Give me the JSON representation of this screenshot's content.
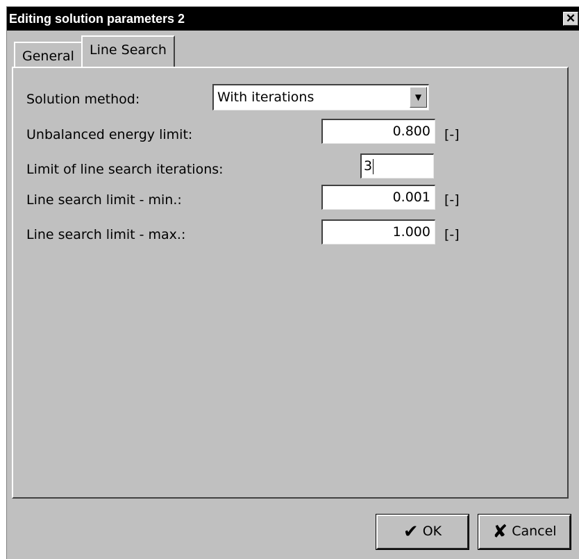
{
  "window": {
    "title": "Editing solution parameters 2",
    "close_glyph": "✕"
  },
  "tabs": [
    {
      "label": "General",
      "active": false
    },
    {
      "label": "Line Search",
      "active": true
    }
  ],
  "form": {
    "solution_method": {
      "label": "Solution method:",
      "value": "With iterations",
      "dropdown_glyph": "▼"
    },
    "unbalanced_energy_limit": {
      "label": "Unbalanced energy limit:",
      "value": "0.800",
      "unit": "[-]"
    },
    "line_search_iterations": {
      "label": "Limit of line search iterations:",
      "value": "3"
    },
    "line_search_min": {
      "label": "Line search limit - min.:",
      "value": "0.001",
      "unit": "[-]"
    },
    "line_search_max": {
      "label": "Line search limit - max.:",
      "value": "1.000",
      "unit": "[-]"
    }
  },
  "buttons": {
    "ok": {
      "label": "OK",
      "icon": "check-icon",
      "glyph": "✔"
    },
    "cancel": {
      "label": "Cancel",
      "icon": "x-icon",
      "glyph": "✘"
    }
  }
}
